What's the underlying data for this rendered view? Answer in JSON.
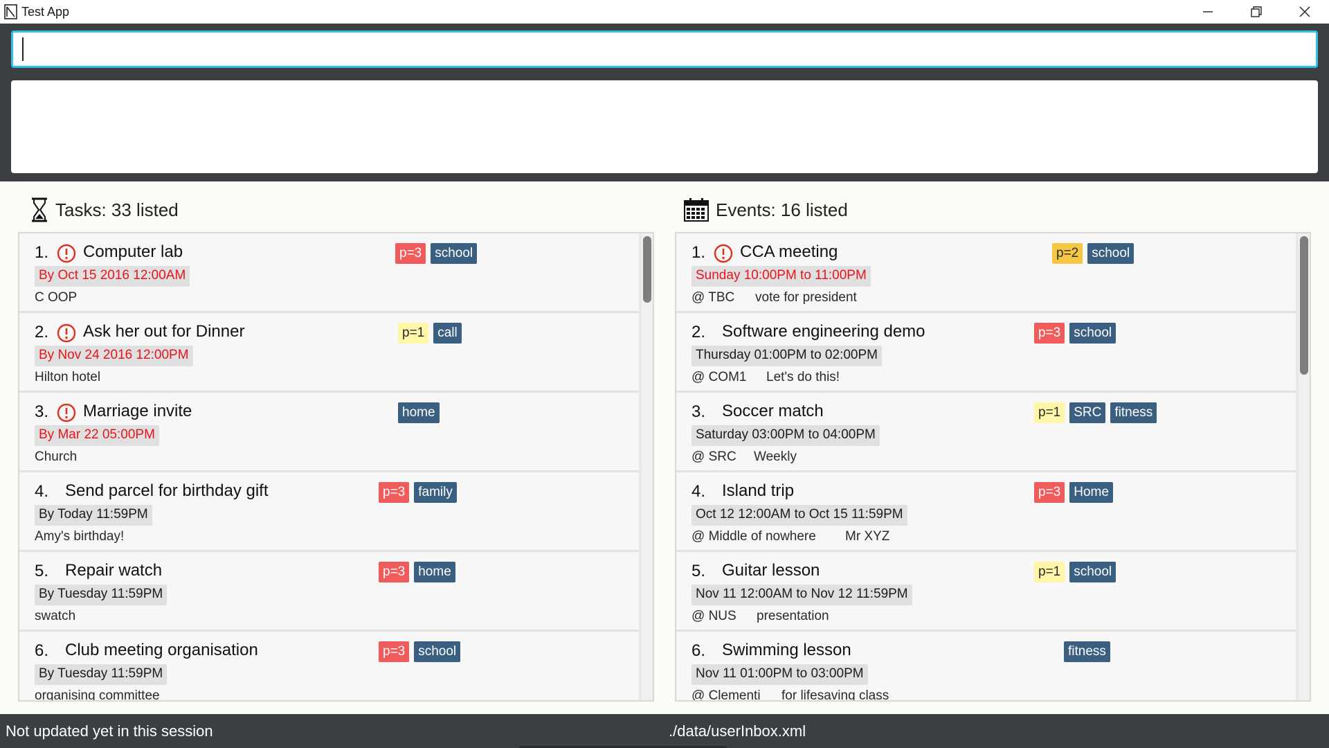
{
  "window": {
    "title": "Test App",
    "icon": "app-icon",
    "controls": [
      "minimize-icon",
      "restore-icon",
      "close-icon"
    ]
  },
  "command": {
    "value": "",
    "placeholder": ""
  },
  "result": {
    "text": ""
  },
  "tasks": {
    "header": "Tasks: 33 listed",
    "icon": "hourglass-icon",
    "items": [
      {
        "num": "1.",
        "alert": true,
        "name": "Computer lab",
        "priority": "p=3",
        "tags": [
          "school"
        ],
        "date": "By Oct 15 2016 12:00AM",
        "date_overdue": true,
        "desc": "C OOP"
      },
      {
        "num": "2.",
        "alert": true,
        "name": "Ask her out for Dinner",
        "priority": "p=1",
        "tags": [
          "call"
        ],
        "date": "By Nov 24 2016 12:00PM",
        "date_overdue": true,
        "desc": "Hilton hotel"
      },
      {
        "num": "3.",
        "alert": true,
        "name": "Marriage invite",
        "priority": "",
        "tags": [
          "home"
        ],
        "date": "By Mar 22 05:00PM",
        "date_overdue": true,
        "desc": "Church"
      },
      {
        "num": "4.",
        "alert": false,
        "name": "Send parcel for birthday gift",
        "priority": "p=3",
        "tags": [
          "family"
        ],
        "date": "By Today 11:59PM",
        "date_overdue": false,
        "desc": "Amy's birthday!"
      },
      {
        "num": "5.",
        "alert": false,
        "name": "Repair watch",
        "priority": "p=3",
        "tags": [
          "home"
        ],
        "date": "By Tuesday 11:59PM",
        "date_overdue": false,
        "desc": "swatch"
      },
      {
        "num": "6.",
        "alert": false,
        "name": "Club meeting organisation",
        "priority": "p=3",
        "tags": [
          "school"
        ],
        "date": "By Tuesday 11:59PM",
        "date_overdue": false,
        "desc": "organising committee"
      }
    ]
  },
  "events": {
    "header": "Events: 16 listed",
    "icon": "calendar-icon",
    "items": [
      {
        "num": "1.",
        "alert": true,
        "name": "CCA meeting",
        "priority": "p=2",
        "tags": [
          "school"
        ],
        "date": "Sunday 10:00PM to 11:00PM",
        "date_overdue": true,
        "venue": "@ TBC",
        "desc": "vote for president"
      },
      {
        "num": "2.",
        "alert": false,
        "name": "Software engineering demo",
        "priority": "p=3",
        "tags": [
          "school"
        ],
        "date": "Thursday 01:00PM to 02:00PM",
        "date_overdue": false,
        "venue": "@ COM1",
        "desc": "Let's do this!"
      },
      {
        "num": "3.",
        "alert": false,
        "name": "Soccer match",
        "priority": "p=1",
        "tags": [
          "SRC",
          "fitness"
        ],
        "date": "Saturday 03:00PM to 04:00PM",
        "date_overdue": false,
        "venue": "@ SRC",
        "desc": "Weekly"
      },
      {
        "num": "4.",
        "alert": false,
        "name": "Island trip",
        "priority": "p=3",
        "tags": [
          "Home"
        ],
        "date": "Oct 12 12:00AM to Oct 15 11:59PM",
        "date_overdue": false,
        "venue": "@ Middle of nowhere",
        "desc": "Mr XYZ"
      },
      {
        "num": "5.",
        "alert": false,
        "name": "Guitar lesson",
        "priority": "p=1",
        "tags": [
          "school"
        ],
        "date": "Nov 11 12:00AM to Nov 12 11:59PM",
        "date_overdue": false,
        "venue": "@ NUS",
        "desc": "presentation"
      },
      {
        "num": "6.",
        "alert": false,
        "name": "Swimming lesson",
        "priority": "",
        "tags": [
          "fitness"
        ],
        "date": "Nov 11 01:00PM to 03:00PM",
        "date_overdue": false,
        "venue": "@ Clementi",
        "desc": "for lifesaving class"
      }
    ]
  },
  "status": {
    "sync": "Not updated yet in this session",
    "file": "./data/userInbox.xml"
  },
  "colors": {
    "accent": "#2fc1e6",
    "dark": "#3c3f41",
    "tag": "#3b5f80",
    "p3": "#f05b5b",
    "p2": "#f6c744",
    "p1": "#fff6a8",
    "overdue": "#e8141b"
  }
}
